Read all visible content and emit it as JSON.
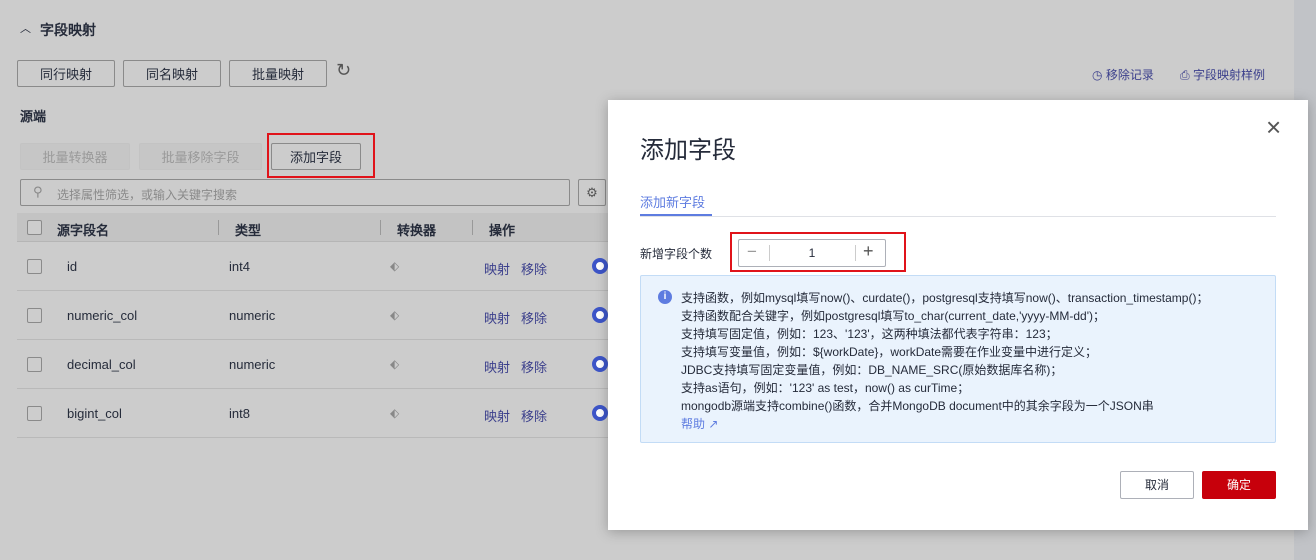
{
  "section": {
    "title": "字段映射"
  },
  "toolbar": {
    "row_map": "同行映射",
    "name_map": "同名映射",
    "batch_map": "批量映射",
    "remove_record": "移除记录",
    "mapping_sample": "字段映射样例"
  },
  "source": {
    "title": "源端",
    "batch_converter": "批量转换器",
    "batch_remove": "批量移除字段",
    "add_field": "添加字段",
    "search_placeholder": "选择属性筛选，或输入关键字搜索"
  },
  "table": {
    "headers": [
      "源字段名",
      "类型",
      "转换器",
      "操作"
    ],
    "rows": [
      {
        "name": "id",
        "type": "int4"
      },
      {
        "name": "numeric_col",
        "type": "numeric"
      },
      {
        "name": "decimal_col",
        "type": "numeric"
      },
      {
        "name": "bigint_col",
        "type": "int8"
      }
    ],
    "map_label": "映射",
    "remove_label": "移除"
  },
  "dialog": {
    "title": "添加字段",
    "tab": "添加新字段",
    "count_label": "新增字段个数",
    "count_value": "1",
    "info_lines": [
      "支持函数，例如mysql填写now()、curdate()，postgresql支持填写now()、transaction_timestamp()；",
      "支持函数配合关键字，例如postgresql填写to_char(current_date,'yyyy-MM-dd')；",
      "支持填写固定值，例如：123、'123'，这两种填法都代表字符串：123；",
      "支持填写变量值，例如：${workDate}，workDate需要在作业变量中进行定义；",
      "JDBC支持填写固定变量值，例如：DB_NAME_SRC(原始数据库名称)；",
      "支持as语句，例如：'123' as test，now() as curTime；",
      "mongodb源端支持combine()函数，合并MongoDB document中的其余字段为一个JSON串"
    ],
    "help": "帮助",
    "cancel": "取消",
    "confirm": "确定"
  },
  "colors": {
    "accent": "#5e7ce0",
    "danger": "#c7000b",
    "highlight": "#e0131a"
  }
}
